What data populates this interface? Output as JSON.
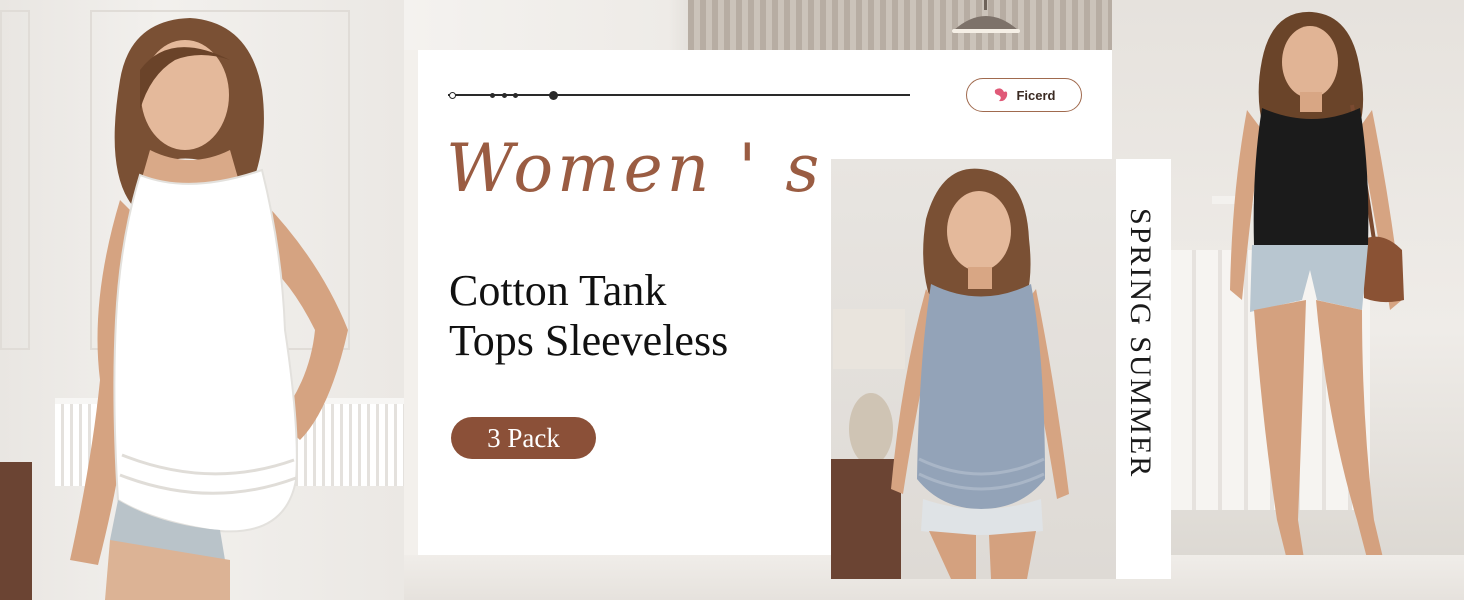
{
  "brand": {
    "name": "Ficerd"
  },
  "headline": {
    "script": "Women ' s",
    "line1": "Cotton Tank",
    "line2": "Tops Sleeveless"
  },
  "badge": {
    "label": "3 Pack"
  },
  "season": {
    "text": "SPRING  SUMMER"
  },
  "colors": {
    "accent": "#8b5038",
    "script": "#9a5c42",
    "white_top": "#ffffff",
    "grey_top": "#93a3b8",
    "black_top": "#1b1b1b"
  },
  "icons": [
    "brand-logo-icon",
    "decorative-line-icon"
  ]
}
